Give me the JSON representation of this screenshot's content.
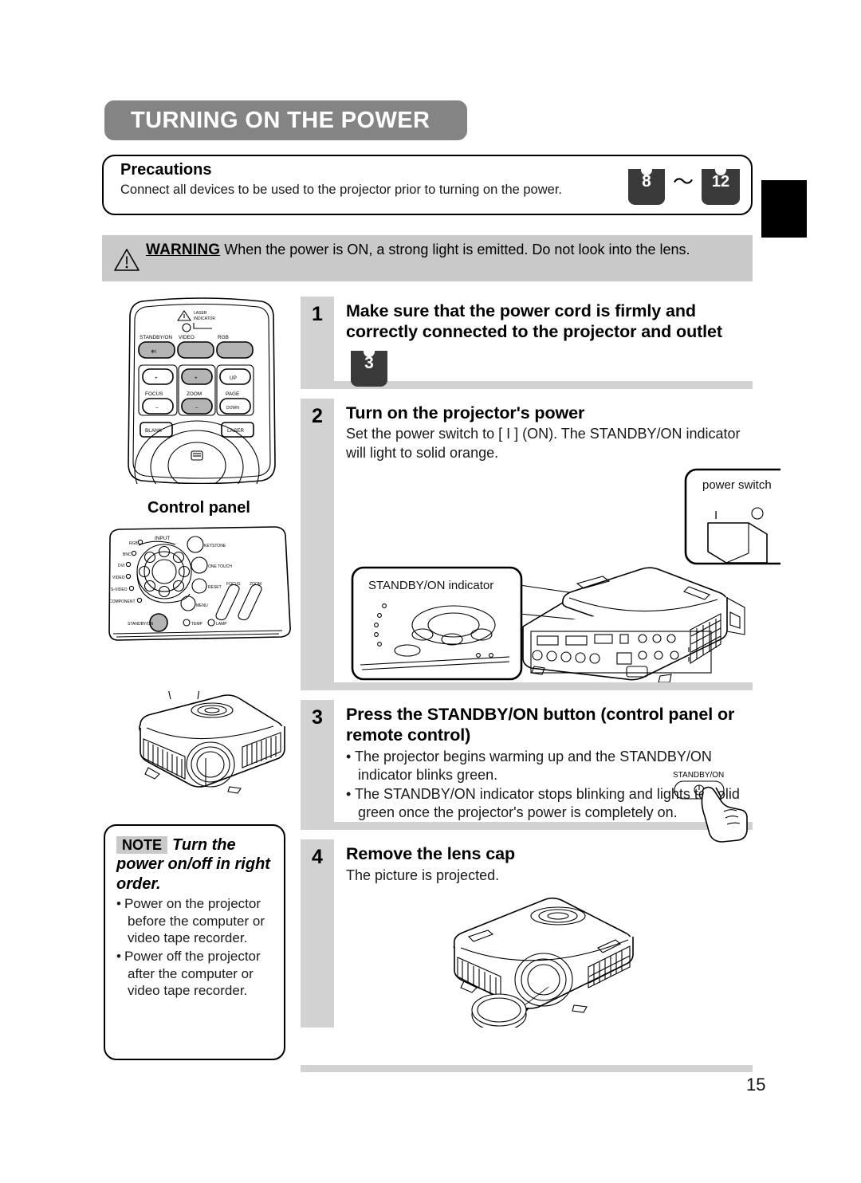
{
  "page": {
    "title": "TURNING ON THE POWER",
    "page_number": "15",
    "index_tab": "black-tab"
  },
  "precautions": {
    "heading": "Precautions",
    "text": "Connect all devices to be used to the projector prior to turning on the power.",
    "ref_from": "8",
    "ref_separator": "〜",
    "ref_to": "12"
  },
  "warning": {
    "label": "WARNING",
    "text": "When the power is ON, a strong light is emitted. Do not look into the lens.",
    "icon": "warning-triangle-icon"
  },
  "illustrations": {
    "remote": {
      "caption": "",
      "laser_indicator_label": "LASER\nINDICATOR",
      "buttons": [
        "STANDBY/ON",
        "VIDEO",
        "RGB",
        "FOCUS",
        "ZOOM",
        "PAGE",
        "UP",
        "DOWN",
        "BLANK",
        "LASER"
      ],
      "plus": "+",
      "minus": "–",
      "up": "UP",
      "down": "DOWN"
    },
    "control_panel": {
      "title": "Control panel",
      "input_label": "INPUT",
      "inputs": [
        "RGB",
        "BNC",
        "DVI",
        "VIDEO",
        "S-VIDEO",
        "COMPONENT"
      ],
      "right_buttons": [
        "KEYSTONE",
        "ONE TOUCH",
        "RESET",
        "MENU"
      ],
      "wheels": [
        "FOCUS",
        "ZOOM"
      ],
      "standby_button": "STANDBY/ON",
      "indicators": [
        "TEMP",
        "LAMP"
      ]
    },
    "projector_rear": {
      "standby_callout": "STANDBY/ON indicator",
      "power_switch_callout": "power switch",
      "switch_on_mark": "I",
      "switch_off_mark": "O"
    },
    "standby_press": {
      "label": "STANDBY/ON",
      "icon": "hand-pressing-button-icon"
    }
  },
  "steps": [
    {
      "number": "1",
      "heading": "Make sure that the power cord is firmly and correctly connected to the projector and outlet",
      "body": "",
      "bullets": [],
      "page_ref": "3"
    },
    {
      "number": "2",
      "heading": "Turn on the projector's power",
      "body": "Set the power switch to [ I ] (ON). The STANDBY/ON indicator will light to solid orange.",
      "bullets": [],
      "page_ref": ""
    },
    {
      "number": "3",
      "heading": "Press the STANDBY/ON button (control panel or remote control)",
      "body": "",
      "bullets": [
        "The projector begins warming up and the STANDBY/ON indicator blinks green.",
        "The STANDBY/ON indicator stops blinking and lights to solid green once the projector's power is completely on."
      ],
      "page_ref": ""
    },
    {
      "number": "4",
      "heading": "Remove the lens cap",
      "body": "The picture is projected.",
      "bullets": [],
      "page_ref": ""
    }
  ],
  "note": {
    "tag": "NOTE",
    "title": "Turn the power on/off in right order.",
    "bullets": [
      "Power on the projector before the computer or video tape recorder.",
      "Power off the projector after the computer or video tape recorder."
    ],
    "bullet_char": "•"
  },
  "colors": {
    "title_bar": "#848484",
    "step_gray": "#d2d2d2",
    "warning_gray": "#c9c9c9",
    "book_icon": "#3a3a3a"
  }
}
